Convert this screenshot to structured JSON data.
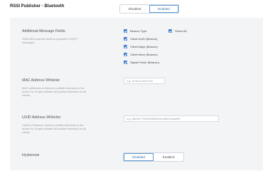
{
  "header": {
    "title": "RSSI Publisher - Bluetooth",
    "toggle": {
      "options": [
        "Disabled",
        "Enabled"
      ],
      "selected": "Enabled"
    }
  },
  "fields": {
    "additional": {
      "label": "Additional Message Fields",
      "help": "Select BLE-specific fields to populate in MQTT messages.",
      "checkboxes": [
        {
          "label": "Beacon Type",
          "checked": true
        },
        {
          "label": "Select All",
          "checked": true
        },
        {
          "label": "Client UUID (Beacon)",
          "checked": true
        },
        {
          "label": "Client Major (Beacon)",
          "checked": true
        },
        {
          "label": "Client Minor (Beacon)",
          "checked": true
        },
        {
          "label": "Signal Power (Beacon)",
          "checked": true
        }
      ]
    },
    "mac_whitelist": {
      "label": "MAC Address Whitelist",
      "help": "MAC addresses of clients to publish telemetry to the broker for. Empty whitelist will publish telemetry for all clients.",
      "placeholder": "e.g. 00:65:ac:f5:e4:59"
    },
    "uuid_whitelist": {
      "label": "UUID Address Whitelist",
      "help": "UUIDs of iBeacon clients to publish telemetry to the broker for. Empty whitelist will publish telemetry for all clients.",
      "placeholder": "e.g. d8b9ee77f0f2f0d9f82af1a38bb1bcad80e"
    },
    "hysteresis": {
      "label": "Hysteresis",
      "toggle": {
        "options": [
          "Disabled",
          "Enabled"
        ],
        "selected": "Disabled"
      }
    }
  },
  "colors": {
    "accent": "#3f78c8",
    "panel": "#f3f4f6"
  }
}
